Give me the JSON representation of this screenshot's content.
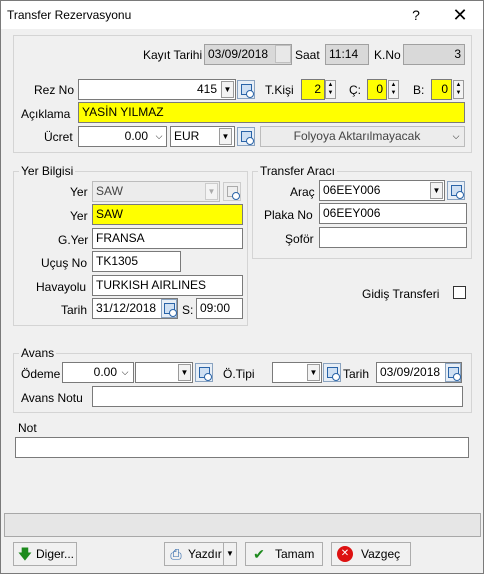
{
  "window": {
    "title": "Transfer Rezervasyonu",
    "help": "?",
    "close": "✕"
  },
  "header": {
    "kayit_tarihi_label": "Kayıt Tarihi",
    "kayit_tarihi_value": "03/09/2018",
    "saat_label": "Saat",
    "saat_value": "11:14",
    "kno_label": "K.No",
    "kno_value": "3"
  },
  "rez": {
    "rez_no_label": "Rez No",
    "rez_no_value": "415",
    "tkisi_label": "T.Kişi",
    "tkisi_value": "2",
    "c_label": "Ç:",
    "c_value": "0",
    "b_label": "B:",
    "b_value": "0"
  },
  "aciklama": {
    "label": "Açıklama",
    "value": "YASİN YILMAZ"
  },
  "ucret": {
    "label": "Ücret",
    "value": "0.00",
    "currency": "EUR",
    "folyo": "Folyoya Aktarılmayacak"
  },
  "yer_bilgisi": {
    "title": "Yer Bilgisi",
    "yer1_label": "Yer",
    "yer1_value": "SAW",
    "yer2_label": "Yer",
    "yer2_value": "SAW",
    "gyer_label": "G.Yer",
    "gyer_value": "FRANSA",
    "ucus_label": "Uçuş No",
    "ucus_value": "TK1305",
    "havayolu_label": "Havayolu",
    "havayolu_value": "TURKISH AIRLINES",
    "tarih_label": "Tarih",
    "tarih_value": "31/12/2018",
    "s_label": "S:",
    "s_value": "09:00"
  },
  "transfer_araci": {
    "title": "Transfer Aracı",
    "arac_label": "Araç",
    "arac_value": "06EEY006",
    "plaka_label": "Plaka No",
    "plaka_value": "06EEY006",
    "sofor_label": "Şoför",
    "sofor_value": ""
  },
  "gidis": {
    "label": "Gidiş Transferi"
  },
  "avans": {
    "title": "Avans",
    "odeme_label": "Ödeme",
    "odeme_value": "0.00",
    "otipi_label": "Ö.Tipi",
    "otipi_value": "",
    "tarih_label": "Tarih",
    "tarih_value": "03/09/2018",
    "notu_label": "Avans Notu",
    "notu_value": ""
  },
  "not": {
    "label": "Not",
    "value": ""
  },
  "buttons": {
    "diger": "Diger...",
    "yazdir": "Yazdır",
    "tamam": "Tamam",
    "vazgec": "Vazgeç"
  }
}
